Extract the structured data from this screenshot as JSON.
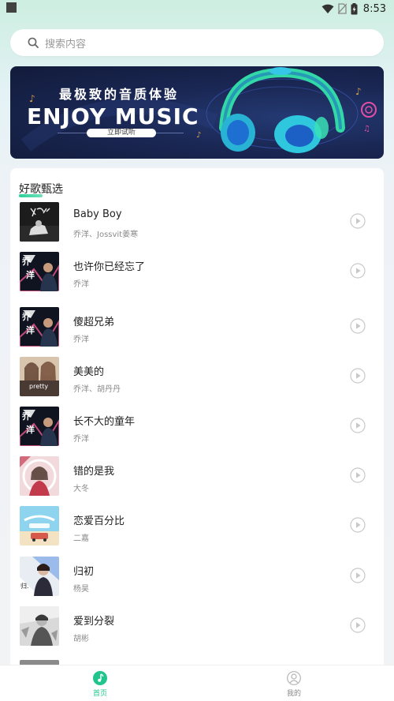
{
  "status_bar": {
    "time": "8:53"
  },
  "search": {
    "placeholder": "搜索内容"
  },
  "banner": {
    "subtitle": "最极致的音质体验",
    "title": "ENJOY MUSIC",
    "button_label": "立即试听"
  },
  "section": {
    "title": "好歌甄选"
  },
  "songs": [
    {
      "title": "Baby Boy",
      "artist": "乔洋、Jossvit姜寒"
    },
    {
      "title": "也许你已经忘了",
      "artist": "乔洋"
    },
    {
      "title": "傻超兄弟",
      "artist": "乔洋"
    },
    {
      "title": "美美的",
      "artist": "乔洋、胡丹丹"
    },
    {
      "title": "长不大的童年",
      "artist": "乔洋"
    },
    {
      "title": "错的是我",
      "artist": "大冬"
    },
    {
      "title": "恋爱百分比",
      "artist": "二嘉"
    },
    {
      "title": "归初",
      "artist": "杨昊"
    },
    {
      "title": "爱到分裂",
      "artist": "胡彬"
    }
  ],
  "nav": {
    "home_label": "首页",
    "mine_label": "我的"
  },
  "colors": {
    "accent": "#1fc58d",
    "banner_bg": "#1a2754"
  }
}
